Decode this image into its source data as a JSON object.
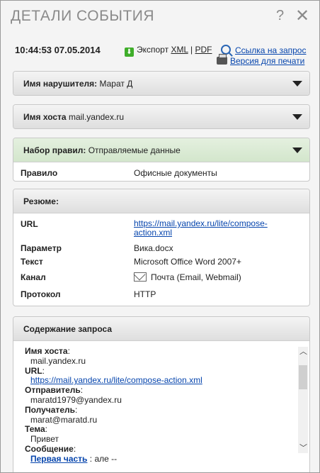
{
  "dialog": {
    "title": "ДЕТАЛИ СОБЫТИЯ",
    "help_label": "?",
    "close_label": "✕"
  },
  "event": {
    "datetime": "10:44:53 07.05.2014"
  },
  "export": {
    "prefix": "Экспорт",
    "xml": "XML",
    "sep": "|",
    "pdf": "PDF",
    "request_link": "Ссылка на запрос",
    "print_link": "Версия для печати"
  },
  "violator": {
    "label": "Имя нарушителя:",
    "value": "Марат Д"
  },
  "host": {
    "label": "Имя хоста",
    "value": "mail.yandex.ru"
  },
  "ruleset": {
    "label": "Набор правил:",
    "value": "Отправляемые данные",
    "rule_label": "Правило",
    "rule_value": "Офисные документы"
  },
  "summary": {
    "title": "Резюме:",
    "rows": [
      {
        "key": "URL",
        "value": "https://mail.yandex.ru/lite/compose-action.xml"
      },
      {
        "key": "Параметр",
        "value": "Вика.docx"
      },
      {
        "key": "Текст",
        "value": "Microsoft Office Word 2007+"
      },
      {
        "key": "Канал",
        "value": "Почта (Email, Webmail)"
      },
      {
        "key": "Протокол",
        "value": "HTTP"
      }
    ],
    "url_line1": "https://mail.yandex.ru/lite/compose-",
    "url_line2": "action.xml"
  },
  "request": {
    "title": "Содержание запроса",
    "host_label": "Имя хоста",
    "host_value": "mail.yandex.ru",
    "url_label": "URL",
    "url_value": "https://mail.yandex.ru/lite/compose-action.xml",
    "sender_label": "Отправитель",
    "sender_value": "maratd1979@yandex.ru",
    "recipient_label": "Получатель",
    "recipient_value": "marat@maratd.ru",
    "subject_label": "Тема",
    "subject_value": "Привет",
    "message_label": "Сообщение",
    "first_part_label": "Первая часть",
    "first_part_value": ": але --"
  },
  "icons": {
    "export": "download-icon",
    "request": "magnifier-icon",
    "print": "printer-icon",
    "channel": "envelope-icon"
  },
  "colors": {
    "link": "#0645ad",
    "ruleset_header": "#d9eacf",
    "export_icon": "#3fae2a"
  }
}
